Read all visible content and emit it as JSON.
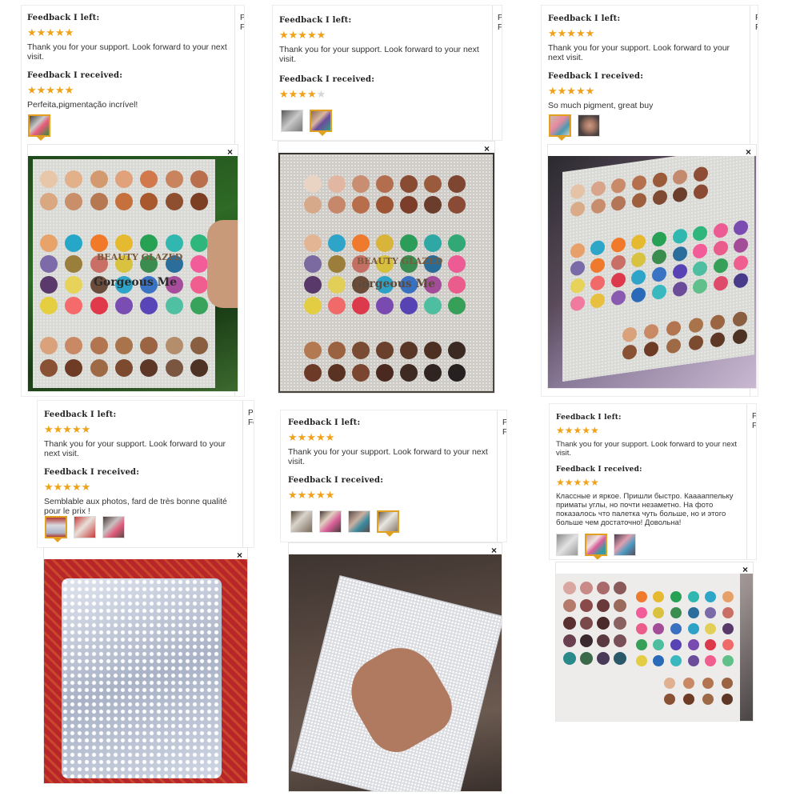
{
  "labels": {
    "left": "Feedback I left:",
    "received": "Feedback I received:",
    "close": "×"
  },
  "icons": {
    "star": "star-icon",
    "close": "close-icon"
  },
  "colors": {
    "star": "#f0a21a",
    "star_off": "#d6d6d6",
    "selected_thumb": "#e2a021"
  },
  "reviews": [
    {
      "left_text": "Thank you for your support. Look forward to your next visit.",
      "received_rating": 5,
      "received_text": "Perfeita,pigmentação incrível!",
      "cut": [
        "P",
        "F"
      ]
    },
    {
      "left_text": "Thank you for your support. Look forward to your next visit.",
      "received_rating": 4,
      "received_text": "",
      "cut": [
        "P",
        "F"
      ]
    },
    {
      "left_text": "Thank you for your support. Look forward to your next visit.",
      "received_rating": 5,
      "received_text": "So much pigment, great buy",
      "cut": [
        "F",
        "F"
      ]
    },
    {
      "left_text": "Thank you for your support. Look forward to your next visit.",
      "received_rating": 5,
      "received_text": "Semblable aux photos, fard de très bonne qualité pour le prix !",
      "cut": [
        "Pu",
        "Fe"
      ]
    },
    {
      "left_text": "Thank you for your support. Look forward to your next visit.",
      "received_rating": 5,
      "received_text": "",
      "cut": [
        "P",
        "F"
      ]
    },
    {
      "left_text": "Thank you for your support. Look forward to your next visit.",
      "received_rating": 5,
      "received_text": "Классные и яркое. Пришли быстро. Кааааппельку приматы углы, но почти незаметно. На фото показалось что палетка чуть больше, но и этого больше чем достаточно! Довольна!",
      "cut": [
        "F",
        "F"
      ]
    }
  ],
  "palette_text": {
    "brand": "BEAUTY GLAZED",
    "model": "Gorgeous Me"
  }
}
